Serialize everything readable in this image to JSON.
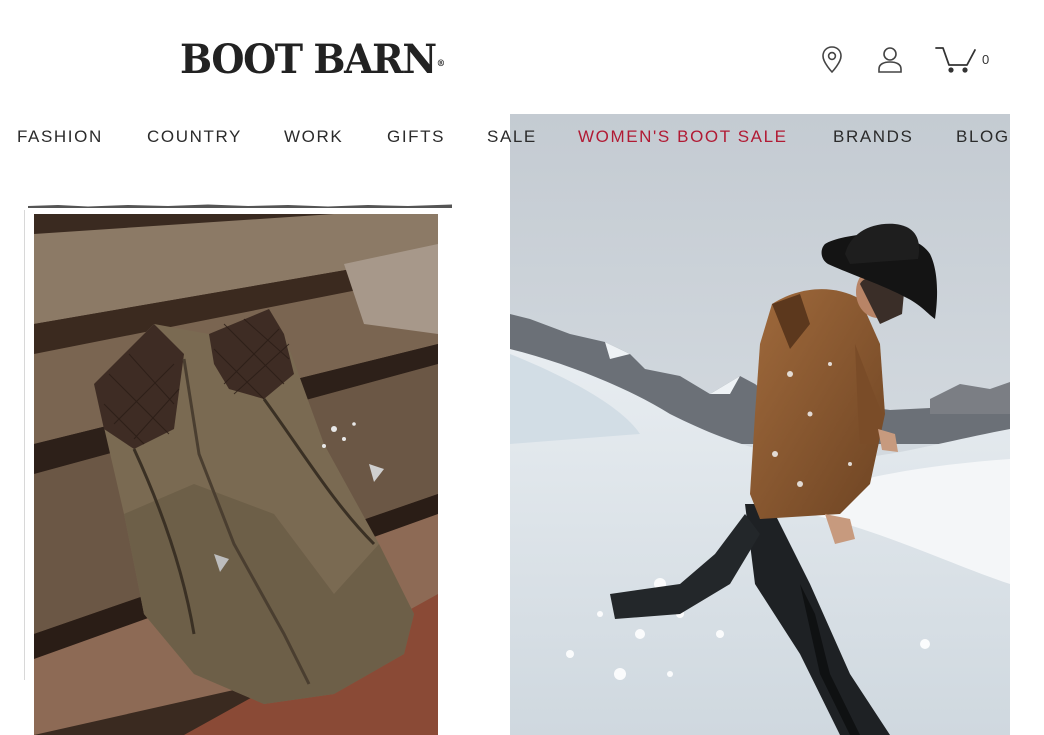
{
  "header": {
    "logo_text": "BOOT BARN",
    "logo_mark": "®",
    "icons": [
      "location-pin-icon",
      "user-account-icon",
      "shopping-cart-icon"
    ],
    "cart_count": "0"
  },
  "nav": {
    "items": [
      {
        "label": "FASHION"
      },
      {
        "label": "COUNTRY"
      },
      {
        "label": "WORK"
      },
      {
        "label": "GIFTS"
      },
      {
        "label": "SALE"
      },
      {
        "label": "WOMEN'S BOOT SALE",
        "color": "#b11a34"
      },
      {
        "label": "BRANDS"
      },
      {
        "label": "BLOG"
      }
    ]
  },
  "colors": {
    "accent_sale": "#b11a34",
    "text_dark": "#2b2b2b",
    "background": "#ffffff"
  }
}
